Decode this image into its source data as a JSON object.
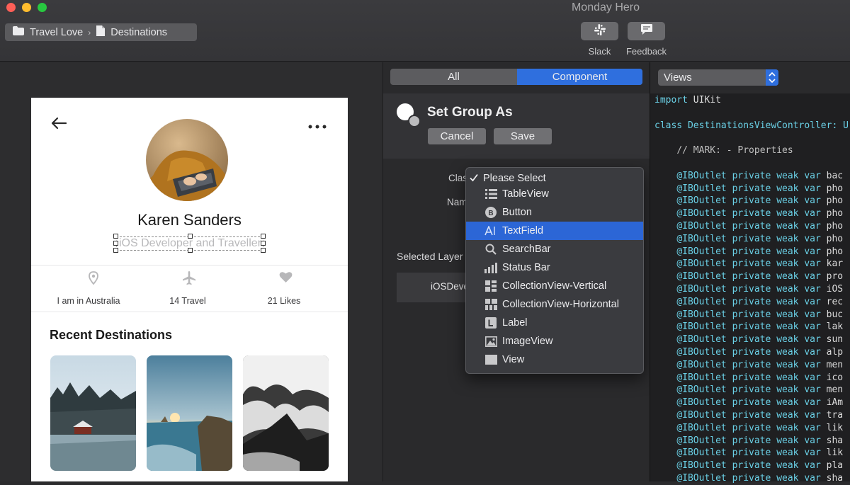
{
  "window": {
    "title": "Monday Hero"
  },
  "breadcrumb": {
    "project": "Travel Love",
    "separator": "›",
    "page": "Destinations"
  },
  "toolbar": {
    "slack_label": "Slack",
    "feedback_label": "Feedback"
  },
  "artboard": {
    "name": "Karen Sanders",
    "role": "iOS Developer and Traveller",
    "stats": [
      {
        "icon": "location-pin-icon",
        "label": "I am in Australia"
      },
      {
        "icon": "airplane-icon",
        "label": "14 Travel"
      },
      {
        "icon": "heart-icon",
        "label": "21 Likes"
      }
    ],
    "recent_title": "Recent Destinations"
  },
  "component_panel": {
    "tabs": [
      "All",
      "Component"
    ],
    "active_tab": "Component",
    "group_title": "Set Group As",
    "cancel_label": "Cancel",
    "save_label": "Save",
    "class_label": "Clas",
    "name_label": "Nam",
    "selected_layer_label": "Selected Layer",
    "selected_layer_value": "iOSDeve"
  },
  "class_menu": {
    "items": [
      {
        "label": "Please Select",
        "checked": true
      },
      {
        "label": "TableView",
        "icon": "list-icon"
      },
      {
        "label": "Button",
        "icon": "button-b-icon"
      },
      {
        "label": "TextField",
        "icon": "textfield-icon",
        "highlighted": true
      },
      {
        "label": "SearchBar",
        "icon": "search-icon"
      },
      {
        "label": "Status Bar",
        "icon": "signal-bars-icon"
      },
      {
        "label": "CollectionView-Vertical",
        "icon": "collection-vertical-icon"
      },
      {
        "label": "CollectionView-Horizontal",
        "icon": "collection-horizontal-icon"
      },
      {
        "label": "Label",
        "icon": "label-l-icon"
      },
      {
        "label": "ImageView",
        "icon": "image-icon"
      },
      {
        "label": "View",
        "icon": "view-rect-icon"
      }
    ]
  },
  "code_panel": {
    "select_value": "Views",
    "line_import": "import UIKit",
    "line_class": "class DestinationsViewController: U",
    "line_mark": "// MARK: - Properties",
    "outlet_prefix": "@IBOutlet private weak var ",
    "outlets": [
      "bac",
      "pho",
      "pho",
      "pho",
      "pho",
      "pho",
      "pho",
      "kar",
      "pro",
      "iOS",
      "rec",
      "buc",
      "lak",
      "sun",
      "alp",
      "men",
      "ico",
      "men",
      "iAm",
      "tra",
      "lik",
      "sha",
      "lik",
      "pla",
      "sha"
    ]
  },
  "colors": {
    "accent": "#2f6fde",
    "code_keyword": "#6ad0e6"
  }
}
